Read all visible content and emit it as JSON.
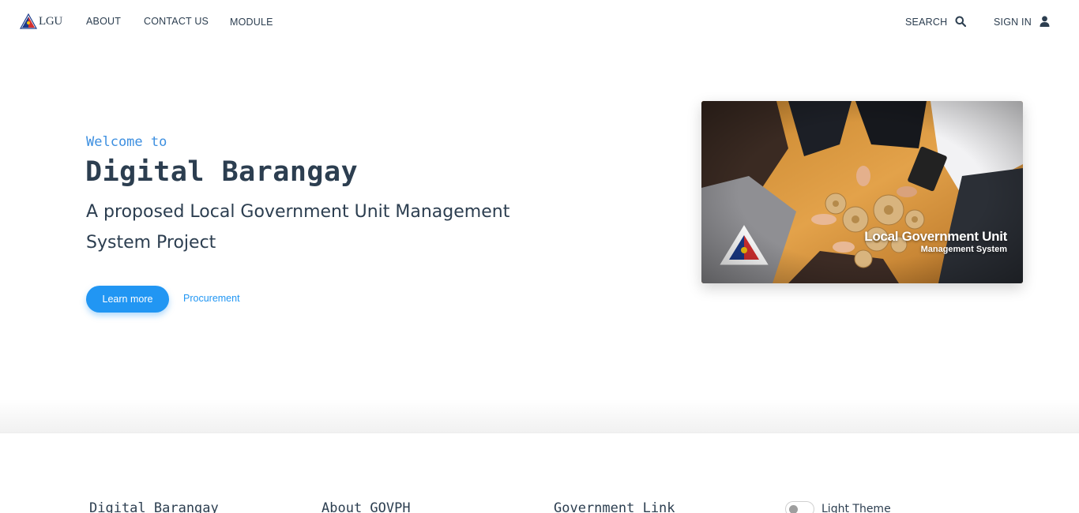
{
  "nav": {
    "brand": "LGU",
    "links": [
      {
        "label": "ABOUT"
      },
      {
        "label": "CONTACT US"
      },
      {
        "label": "MODULE"
      }
    ],
    "search_label": "SEARCH",
    "signin_label": "SIGN IN",
    "search_icon": "search-icon",
    "signin_icon": "user-icon"
  },
  "hero": {
    "welcome": "Welcome to",
    "title": "Digital Barangay",
    "subtitle": "A proposed Local Government Unit Management System Project",
    "primary_button": "Learn more",
    "secondary_link": "Procurement",
    "image": {
      "caption_title": "Local Government Unit",
      "caption_sub": "Management System"
    }
  },
  "footer": {
    "columns": [
      {
        "title": "Digital Barangay"
      },
      {
        "title": "About GOVPH"
      },
      {
        "title": "Government Link"
      }
    ],
    "theme_toggle": {
      "label": "Light Theme",
      "on": false
    }
  },
  "colors": {
    "accent": "#2196f3",
    "welcome": "#3d8fe0",
    "text": "#2c3e50"
  }
}
